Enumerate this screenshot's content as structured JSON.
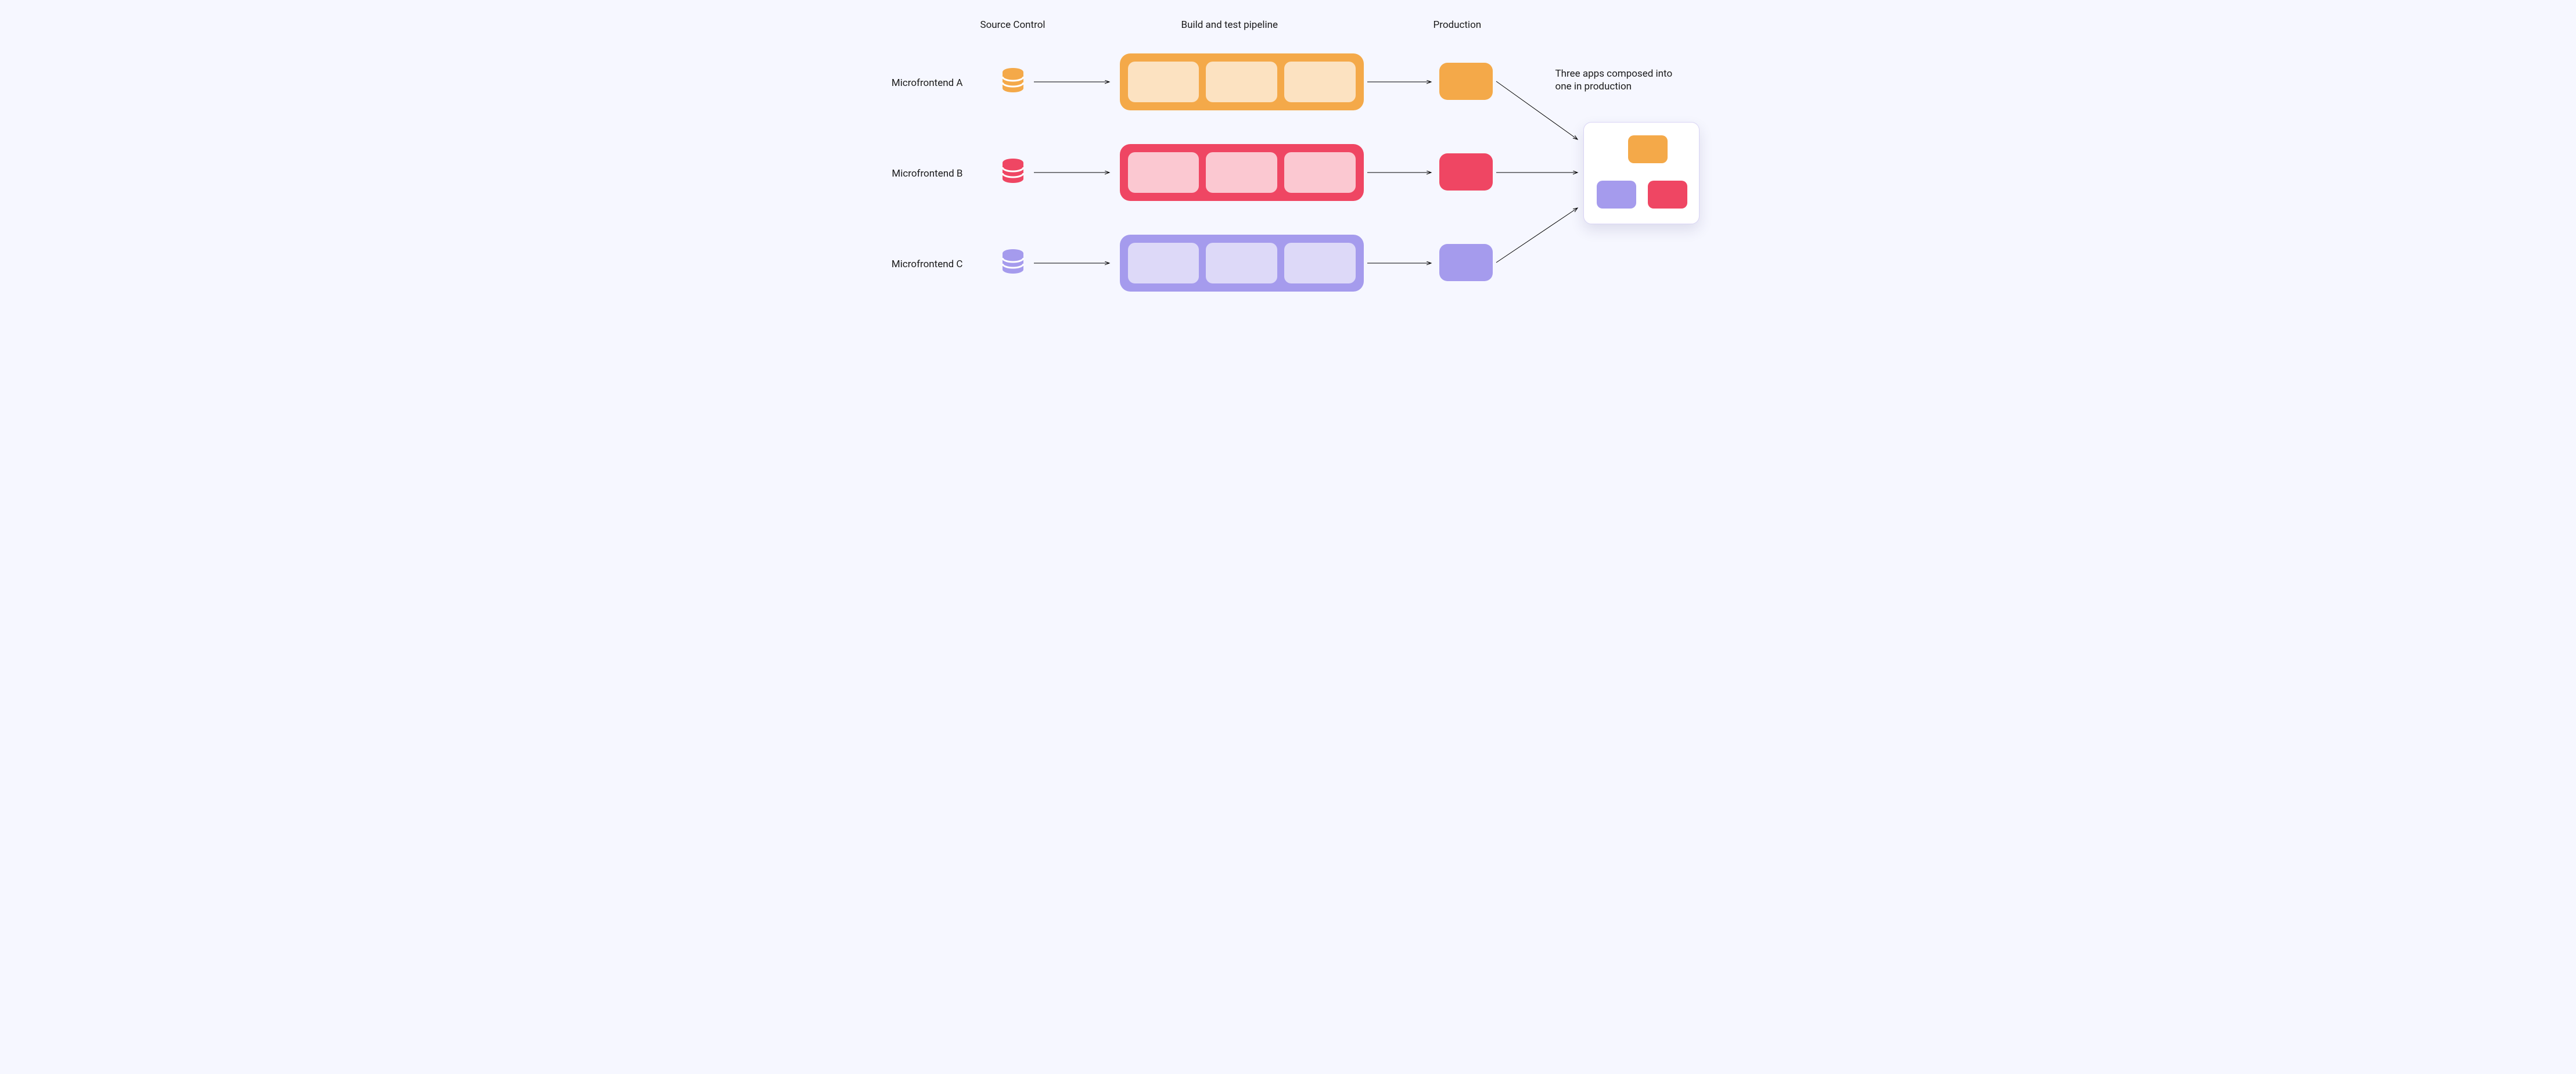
{
  "headers": {
    "source_control": "Source Control",
    "pipeline": "Build and test pipeline",
    "production": "Production"
  },
  "rows": [
    {
      "label": "Microfrontend A",
      "color": "#f4a949",
      "light": "#fce2c1"
    },
    {
      "label": "Microfrontend B",
      "color": "#ef4663",
      "light": "#fbc8d1"
    },
    {
      "label": "Microfrontend C",
      "color": "#a59bed",
      "light": "#ddd9f8"
    }
  ],
  "composed_caption": "Three apps composed into one in production",
  "colors": {
    "orange": "#f4a949",
    "pink": "#ef4663",
    "purple": "#a59bed"
  }
}
